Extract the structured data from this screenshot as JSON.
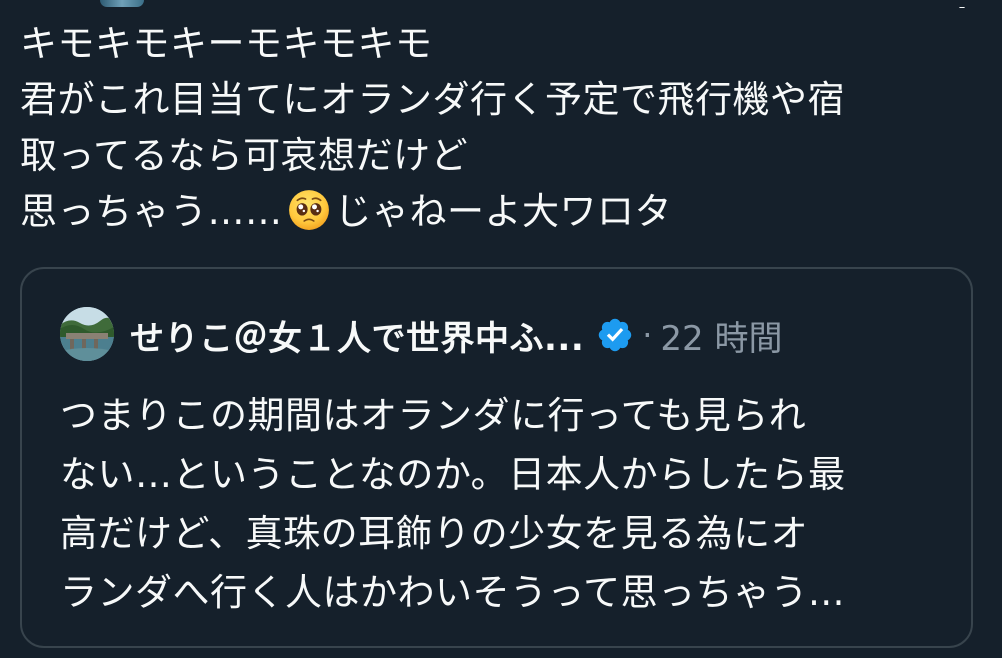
{
  "tweet": {
    "lines": [
      "キモキモキーモキモキモ",
      "君がこれ目当てにオランダ行く予定で飛行機や宿",
      "取ってるなら可哀想だけど",
      "思っちゃう……"
    ],
    "line4_after_emoji": "じゃねーよ大ワロタ",
    "emoji": "pleading-face-emoji"
  },
  "quote": {
    "display_name": "せりこ＠女１人で世界中ふ...",
    "dot": "·",
    "time": "22 時間",
    "lines": [
      "つまりこの期間はオランダに行っても見られ",
      "ない…ということなのか。日本人からしたら最",
      "高だけど、真珠の耳飾りの少女を見る為にオ",
      "ランダへ行く人はかわいそうって思っちゃう..."
    ]
  },
  "colors": {
    "background": "#15202b",
    "text": "#f7f9f9",
    "muted": "#8b98a5",
    "border": "#38444d",
    "verified": "#1d9bf0"
  },
  "icons": {
    "verified": "verified-badge-icon",
    "close": "close-icon"
  }
}
